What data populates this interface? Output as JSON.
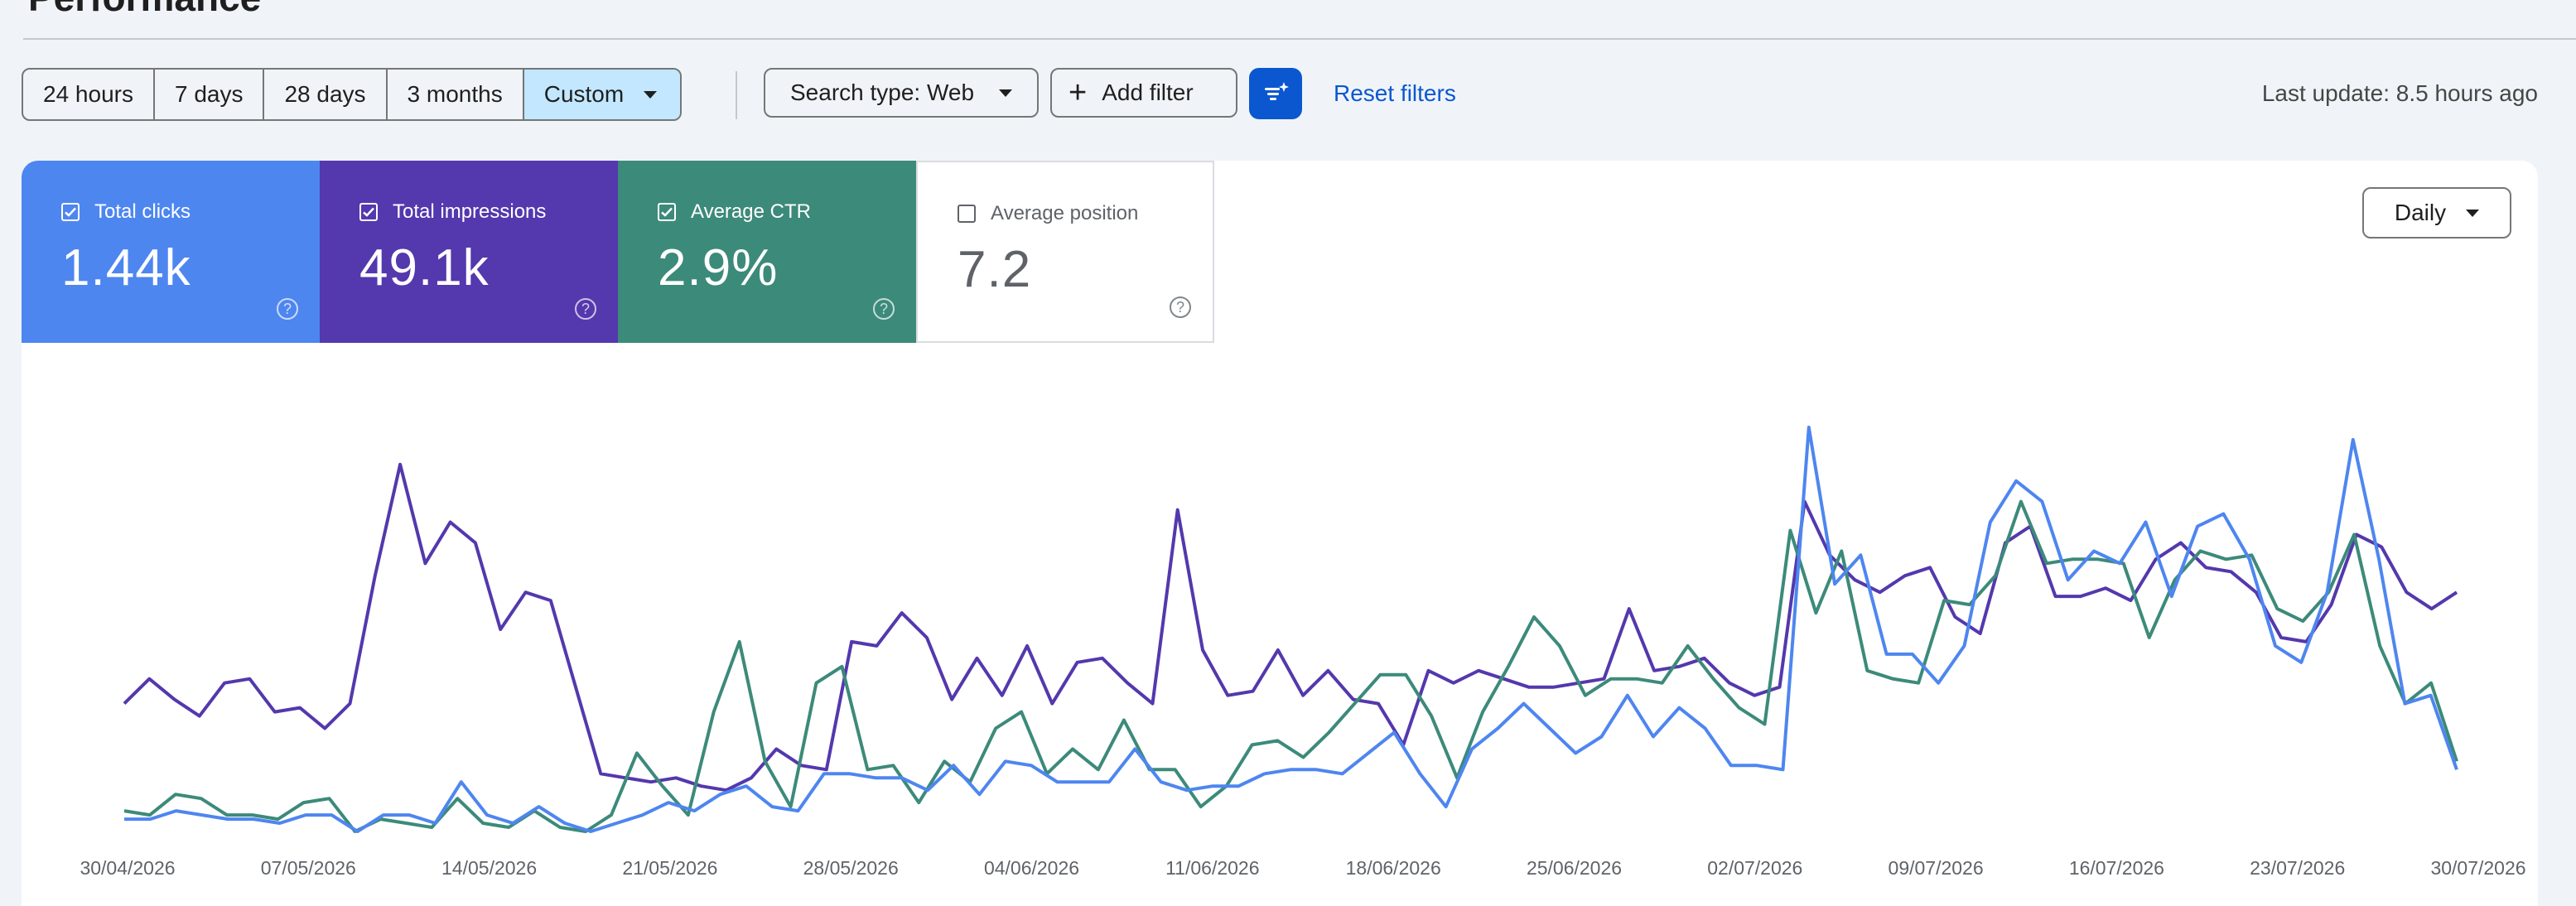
{
  "page": {
    "title": "Performance"
  },
  "toolbar": {
    "ranges": [
      {
        "label": "24 hours",
        "active": false
      },
      {
        "label": "7 days",
        "active": false
      },
      {
        "label": "28 days",
        "active": false
      },
      {
        "label": "3 months",
        "active": false
      },
      {
        "label": "Custom",
        "active": true
      }
    ],
    "search_type_label": "Search type: Web",
    "add_filter_label": "Add filter",
    "filter_icon": "filter-sparkle-icon",
    "reset_filters_label": "Reset filters",
    "last_update": "Last update: 8.5 hours ago"
  },
  "metrics": [
    {
      "label": "Total clicks",
      "value": "1.44k",
      "checked": true,
      "color": "#4e86f0"
    },
    {
      "label": "Total impressions",
      "value": "49.1k",
      "checked": true,
      "color": "#5438ad"
    },
    {
      "label": "Average CTR",
      "value": "2.9%",
      "checked": true,
      "color": "#3c8a7a"
    },
    {
      "label": "Average position",
      "value": "7.2",
      "checked": false,
      "color": "#ffffff"
    }
  ],
  "granularity": {
    "label": "Daily"
  },
  "chart_data": {
    "type": "line",
    "x_tick_labels": [
      "30/04/2026",
      "07/05/2026",
      "14/05/2026",
      "21/05/2026",
      "28/05/2026",
      "04/06/2026",
      "11/06/2026",
      "18/06/2026",
      "25/06/2026",
      "02/07/2026",
      "09/07/2026",
      "16/07/2026",
      "23/07/2026",
      "30/07/2026"
    ],
    "x_start": "30/04/2026",
    "x_end": "30/07/2026",
    "y_axis_visible": false,
    "grid": false,
    "series": [
      {
        "name": "Total impressions",
        "color": "#5438ad",
        "values": [
          0.31,
          0.37,
          0.32,
          0.28,
          0.36,
          0.37,
          0.29,
          0.3,
          0.25,
          0.31,
          0.62,
          0.89,
          0.65,
          0.75,
          0.7,
          0.49,
          0.58,
          0.56,
          0.35,
          0.14,
          0.13,
          0.12,
          0.13,
          0.11,
          0.1,
          0.13,
          0.2,
          0.16,
          0.15,
          0.46,
          0.45,
          0.53,
          0.47,
          0.32,
          0.42,
          0.33,
          0.45,
          0.31,
          0.41,
          0.42,
          0.36,
          0.31,
          0.78,
          0.44,
          0.33,
          0.34,
          0.44,
          0.33,
          0.39,
          0.32,
          0.31,
          0.21,
          0.39,
          0.36,
          0.39,
          0.37,
          0.35,
          0.35,
          0.36,
          0.37,
          0.54,
          0.39,
          0.4,
          0.42,
          0.36,
          0.33,
          0.35,
          0.8,
          0.67,
          0.61,
          0.58,
          0.62,
          0.64,
          0.52,
          0.48,
          0.7,
          0.74,
          0.57,
          0.57,
          0.59,
          0.56,
          0.66,
          0.7,
          0.64,
          0.63,
          0.58,
          0.47,
          0.46,
          0.55,
          0.72,
          0.69,
          0.58,
          0.54,
          0.58
        ]
      },
      {
        "name": "Average CTR",
        "color": "#3c8a7a",
        "values": [
          0.05,
          0.04,
          0.09,
          0.08,
          0.04,
          0.04,
          0.03,
          0.07,
          0.08,
          0.0,
          0.03,
          0.02,
          0.01,
          0.08,
          0.02,
          0.01,
          0.05,
          0.01,
          0.0,
          0.04,
          0.19,
          0.11,
          0.04,
          0.29,
          0.46,
          0.17,
          0.06,
          0.36,
          0.4,
          0.15,
          0.16,
          0.07,
          0.17,
          0.12,
          0.25,
          0.29,
          0.14,
          0.2,
          0.15,
          0.27,
          0.15,
          0.15,
          0.06,
          0.11,
          0.21,
          0.22,
          0.18,
          0.24,
          0.31,
          0.38,
          0.38,
          0.28,
          0.13,
          0.29,
          0.4,
          0.52,
          0.45,
          0.33,
          0.37,
          0.37,
          0.36,
          0.45,
          0.37,
          0.3,
          0.26,
          0.73,
          0.53,
          0.68,
          0.39,
          0.37,
          0.36,
          0.56,
          0.55,
          0.62,
          0.8,
          0.65,
          0.66,
          0.66,
          0.65,
          0.47,
          0.61,
          0.68,
          0.66,
          0.67,
          0.54,
          0.51,
          0.58,
          0.72,
          0.45,
          0.31,
          0.36,
          0.17
        ]
      },
      {
        "name": "Total clicks",
        "color": "#4e86f0",
        "values": [
          0.03,
          0.03,
          0.05,
          0.04,
          0.03,
          0.03,
          0.02,
          0.04,
          0.04,
          0.0,
          0.04,
          0.04,
          0.02,
          0.12,
          0.04,
          0.02,
          0.06,
          0.02,
          0.0,
          0.02,
          0.04,
          0.07,
          0.05,
          0.09,
          0.11,
          0.06,
          0.05,
          0.14,
          0.14,
          0.13,
          0.13,
          0.1,
          0.16,
          0.09,
          0.17,
          0.16,
          0.12,
          0.12,
          0.12,
          0.2,
          0.12,
          0.1,
          0.11,
          0.11,
          0.14,
          0.15,
          0.15,
          0.14,
          0.19,
          0.24,
          0.14,
          0.06,
          0.2,
          0.25,
          0.31,
          0.25,
          0.19,
          0.23,
          0.33,
          0.23,
          0.3,
          0.25,
          0.16,
          0.16,
          0.15,
          0.98,
          0.6,
          0.67,
          0.43,
          0.43,
          0.36,
          0.45,
          0.75,
          0.85,
          0.8,
          0.61,
          0.68,
          0.65,
          0.75,
          0.57,
          0.74,
          0.77,
          0.66,
          0.45,
          0.41,
          0.58,
          0.95,
          0.66,
          0.31,
          0.33,
          0.15
        ]
      }
    ]
  }
}
